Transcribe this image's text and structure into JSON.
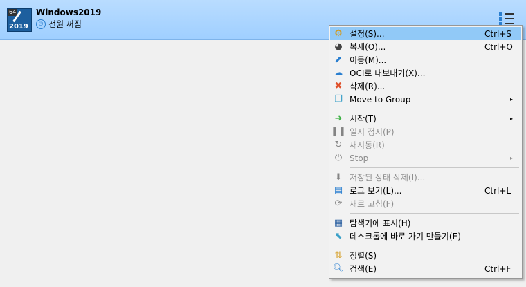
{
  "vm": {
    "os_badge": "64",
    "os_version": "2019",
    "name": "Windows2019",
    "state": "전원 꺼짐"
  },
  "menu": {
    "items": [
      {
        "label": "설정(S)...",
        "shortcut": "Ctrl+S",
        "icon": "gear-icon"
      },
      {
        "label": "복제(O)...",
        "shortcut": "Ctrl+O",
        "icon": "sheep-clone-icon"
      },
      {
        "label": "이동(M)...",
        "shortcut": "",
        "icon": "move-icon"
      },
      {
        "label": "OCI로 내보내기(X)...",
        "shortcut": "",
        "icon": "cloud-export-icon"
      },
      {
        "label": "삭제(R)...",
        "shortcut": "",
        "icon": "delete-x-icon"
      },
      {
        "label": "Move to Group",
        "shortcut": "",
        "icon": "group-icon"
      },
      {
        "label": "시작(T)",
        "shortcut": "",
        "icon": "start-arrow-icon"
      },
      {
        "label": "일시 정지(P)",
        "shortcut": "",
        "icon": "pause-icon"
      },
      {
        "label": "재시동(R)",
        "shortcut": "",
        "icon": "restart-icon"
      },
      {
        "label": "Stop",
        "shortcut": "",
        "icon": "power-icon"
      },
      {
        "label": "저장된 상태 삭제(I)...",
        "shortcut": "",
        "icon": "discard-state-icon"
      },
      {
        "label": "로그 보기(L)...",
        "shortcut": "Ctrl+L",
        "icon": "log-icon"
      },
      {
        "label": "새로 고침(F)",
        "shortcut": "",
        "icon": "refresh-icon"
      },
      {
        "label": "탐색기에 표시(H)",
        "shortcut": "",
        "icon": "explorer-icon"
      },
      {
        "label": "데스크톱에 바로 가기 만들기(E)",
        "shortcut": "",
        "icon": "shortcut-icon"
      },
      {
        "label": "정렬(S)",
        "shortcut": "",
        "icon": "sort-icon"
      },
      {
        "label": "검색(E)",
        "shortcut": "Ctrl+F",
        "icon": "search-icon"
      }
    ]
  },
  "colors": {
    "header_bg": "#a8d4ff",
    "menu_selected": "#91c9f7",
    "disabled_text": "#8d8d8d"
  }
}
